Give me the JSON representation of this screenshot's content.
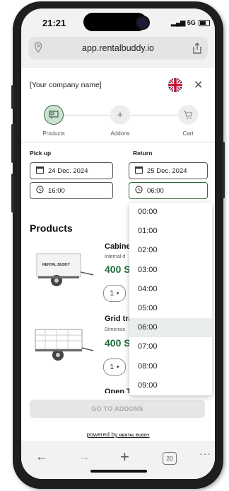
{
  "status_bar": {
    "time": "21:21",
    "network": "5G"
  },
  "browser": {
    "url": "app.rentalbuddy.io",
    "tab_count": "20"
  },
  "header": {
    "company": "[Your company name]"
  },
  "steps": [
    {
      "label": "Products",
      "active": true
    },
    {
      "label": "Addons",
      "active": false
    },
    {
      "label": "Cart",
      "active": false
    }
  ],
  "pickup": {
    "label": "Pick up",
    "date": "24 Dec. 2024",
    "time": "16:00"
  },
  "return": {
    "label": "Return",
    "date": "25 Dec. 2024",
    "time": "06:00"
  },
  "products": {
    "title": "Products",
    "items": [
      {
        "name": "Cabine",
        "desc": "Internal d",
        "price": "400 S",
        "qty": "1"
      },
      {
        "name": "Grid tra",
        "desc": "Dimensio",
        "price": "400 S",
        "qty": "1"
      },
      {
        "name": "Open T",
        "desc": "",
        "price": "",
        "qty": ""
      }
    ]
  },
  "trailer_logo_text": "RENTAL BUDDY",
  "goto_button": "GO TO ADDONS",
  "powered_by": "powered by",
  "powered_brand": "RENTAL BUDDY",
  "time_options": [
    "00:00",
    "01:00",
    "02:00",
    "03:00",
    "04:00",
    "05:00",
    "06:00",
    "07:00",
    "08:00",
    "09:00"
  ],
  "selected_time": "06:00",
  "colors": {
    "accent": "#1f6b3a",
    "selected_bg": "#e8efea"
  }
}
